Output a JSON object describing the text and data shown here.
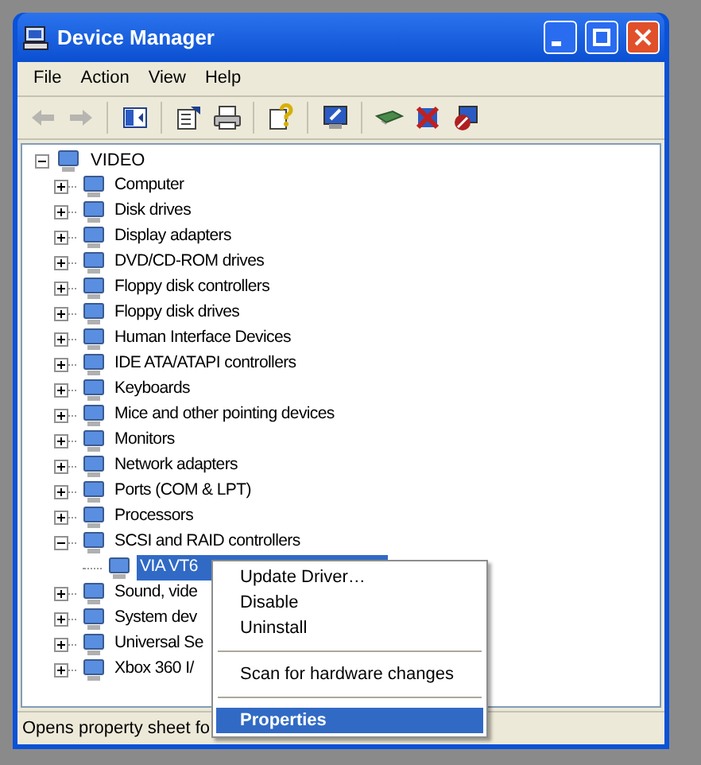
{
  "window": {
    "title": "Device Manager"
  },
  "menu": [
    "File",
    "Action",
    "View",
    "Help"
  ],
  "toolbar": [
    {
      "kind": "back",
      "disabled": true
    },
    {
      "kind": "forward",
      "disabled": true
    },
    {
      "kind": "tree"
    },
    {
      "kind": "properties"
    },
    {
      "kind": "print"
    },
    {
      "kind": "help"
    },
    {
      "kind": "scan"
    },
    {
      "kind": "update"
    },
    {
      "kind": "uninstall"
    },
    {
      "kind": "disable"
    }
  ],
  "tree": {
    "label": "VIDEO",
    "expanded": true,
    "children": [
      {
        "label": "Computer",
        "expanded": false
      },
      {
        "label": "Disk drives",
        "expanded": false
      },
      {
        "label": "Display adapters",
        "expanded": false
      },
      {
        "label": "DVD/CD-ROM drives",
        "expanded": false
      },
      {
        "label": "Floppy disk controllers",
        "expanded": false
      },
      {
        "label": "Floppy disk drives",
        "expanded": false
      },
      {
        "label": "Human Interface Devices",
        "expanded": false
      },
      {
        "label": "IDE ATA/ATAPI controllers",
        "expanded": false
      },
      {
        "label": "Keyboards",
        "expanded": false
      },
      {
        "label": "Mice and other pointing devices",
        "expanded": false
      },
      {
        "label": "Monitors",
        "expanded": false
      },
      {
        "label": "Network adapters",
        "expanded": false
      },
      {
        "label": "Ports (COM & LPT)",
        "expanded": false
      },
      {
        "label": "Processors",
        "expanded": false
      },
      {
        "label": "SCSI and RAID controllers",
        "expanded": true,
        "children": [
          {
            "label": "VIA VT6",
            "selected": true
          }
        ]
      },
      {
        "label": "Sound, vide",
        "expanded": false
      },
      {
        "label": "System dev",
        "expanded": false
      },
      {
        "label": "Universal Se",
        "expanded": false
      },
      {
        "label": "Xbox 360 I/",
        "expanded": false
      }
    ]
  },
  "context_menu": [
    {
      "kind": "item",
      "label": "Update Driver…",
      "selected": false,
      "bold": false
    },
    {
      "kind": "item",
      "label": "Disable",
      "selected": false,
      "bold": false
    },
    {
      "kind": "item",
      "label": "Uninstall",
      "selected": false,
      "bold": false
    },
    {
      "kind": "separator"
    },
    {
      "kind": "item",
      "label": "Scan for hardware changes",
      "selected": false,
      "bold": false
    },
    {
      "kind": "separator"
    },
    {
      "kind": "item",
      "label": "Properties",
      "selected": true,
      "bold": true
    }
  ],
  "status_bar": "Opens property sheet fo"
}
